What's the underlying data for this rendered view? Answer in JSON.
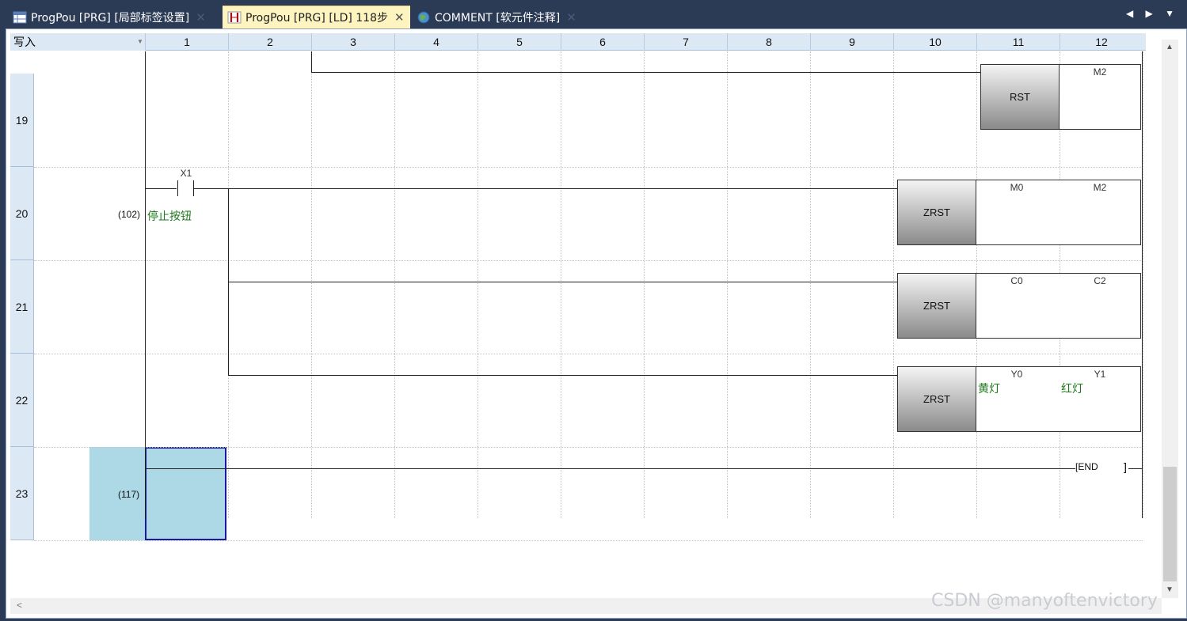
{
  "tabs": [
    {
      "label": "ProgPou [PRG] [局部标签设置]",
      "active": false
    },
    {
      "label": "ProgPou [PRG] [LD] 118步",
      "active": true
    },
    {
      "label": "COMMENT [软元件注释]",
      "active": false
    }
  ],
  "toolbar": {
    "mode": "写入",
    "nav": "◀ ▶ ▼"
  },
  "columns": [
    "1",
    "2",
    "3",
    "4",
    "5",
    "6",
    "7",
    "8",
    "9",
    "10",
    "11",
    "12"
  ],
  "rows": [
    {
      "num": "19",
      "step": ""
    },
    {
      "num": "20",
      "step": "(102)"
    },
    {
      "num": "21",
      "step": ""
    },
    {
      "num": "22",
      "step": ""
    },
    {
      "num": "23",
      "step": "(117)"
    }
  ],
  "ladder": {
    "contact_x1": {
      "device": "X1",
      "comment": "停止按钮"
    },
    "rst": {
      "instr": "RST",
      "operand": "M2"
    },
    "zrst1": {
      "instr": "ZRST",
      "op1": "M0",
      "op2": "M2"
    },
    "zrst2": {
      "instr": "ZRST",
      "op1": "C0",
      "op2": "C2"
    },
    "zrst3": {
      "instr": "ZRST",
      "op1": "Y0",
      "op2": "Y1",
      "cmt1": "黄灯",
      "cmt2": "红灯"
    },
    "end": "END"
  },
  "watermark": "CSDN @manyoftenvictory",
  "colors": {
    "comment": "#1a7a1a",
    "selection": "#add8e6",
    "header": "#dce9f5"
  }
}
